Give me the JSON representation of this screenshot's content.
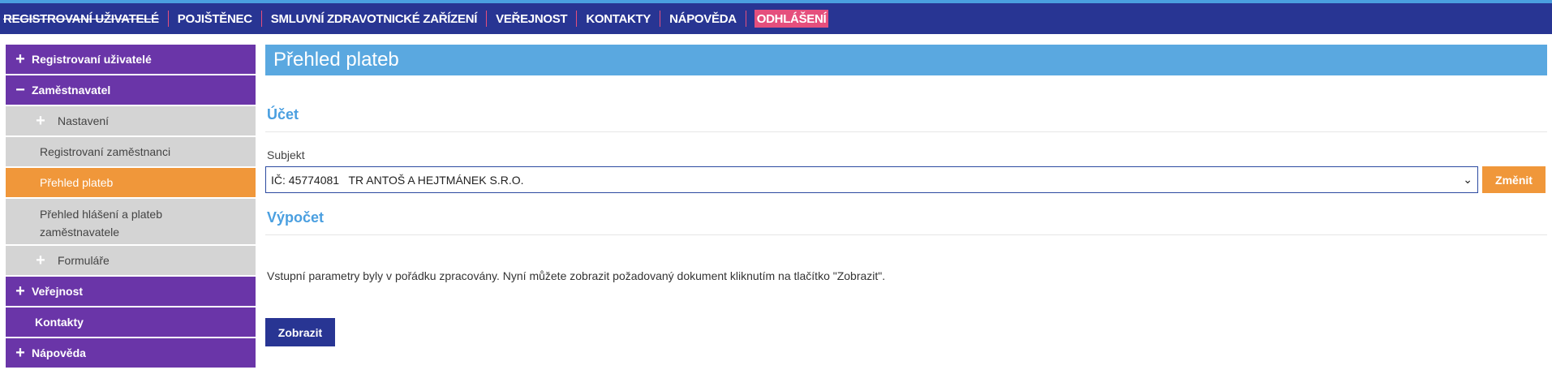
{
  "topnav": {
    "items": [
      "REGISTROVANÍ UŽIVATELÉ",
      "POJIŠTĚNEC",
      "SMLUVNÍ ZDRAVOTNICKÉ ZAŘÍZENÍ",
      "VEŘEJNOST",
      "KONTAKTY",
      "NÁPOVĚDA"
    ],
    "logout": "ODHLÁŠENÍ"
  },
  "sidebar": {
    "registered_users": "Registrovaní uživatelé",
    "employer": "Zaměstnavatel",
    "settings": "Nastavení",
    "registered_employees": "Registrovaní zaměstnanci",
    "payment_overview": "Přehled plateb",
    "reports_overview": "Přehled hlášení a plateb zaměstnavatele",
    "forms": "Formuláře",
    "public": "Veřejnost",
    "contacts": "Kontakty",
    "help": "Nápověda"
  },
  "icons": {
    "plus": "+",
    "minus": "−",
    "chevron": "⌄"
  },
  "main": {
    "title": "Přehled plateb",
    "account_heading": "Účet",
    "subject_label": "Subjekt",
    "subject_value": "IČ: 45774081   TR ANTOŠ A HEJTMÁNEK S.R.O.",
    "change_button": "Změnit",
    "calc_heading": "Výpočet",
    "info_text": "Vstupní parametry byly v pořádku zpracovány. Nyní můžete zobrazit požadovaný dokument kliknutím na tlačítko \"Zobrazit\".",
    "show_button": "Zobrazit"
  },
  "colors": {
    "nav": "#283593",
    "accent_pink": "#e54f7d",
    "purple": "#6a35a8",
    "orange": "#f0973a",
    "title_blue": "#5aa8e0"
  }
}
